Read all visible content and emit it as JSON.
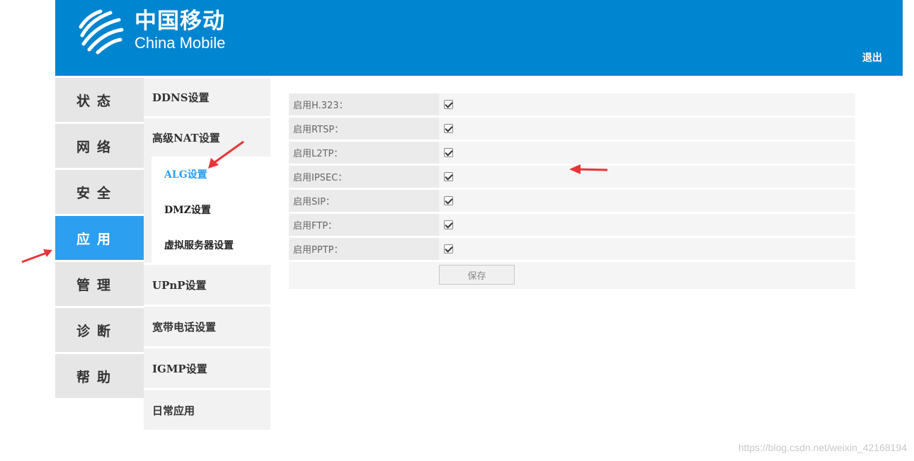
{
  "header": {
    "brand_cn": "中国移动",
    "brand_en": "China Mobile",
    "logout_label": "退出",
    "bg_color": "#0085d0"
  },
  "main_nav": [
    {
      "label": "状态",
      "active": false
    },
    {
      "label": "网络",
      "active": false
    },
    {
      "label": "安全",
      "active": false
    },
    {
      "label": "应用",
      "active": true
    },
    {
      "label": "管理",
      "active": false
    },
    {
      "label": "诊断",
      "active": false
    },
    {
      "label": "帮助",
      "active": false
    }
  ],
  "sub_nav": {
    "ddns": "DDNS设置",
    "nat": "高级NAT设置",
    "nat_children": [
      "ALG设置",
      "DMZ设置",
      "虚拟服务器设置"
    ],
    "upnp": "UPnP设置",
    "voip": "宽带电话设置",
    "igmp": "IGMP设置",
    "daily": "日常应用"
  },
  "alg_form": {
    "rows": [
      {
        "label": "启用H.323：",
        "checked": true
      },
      {
        "label": "启用RTSP：",
        "checked": true
      },
      {
        "label": "启用L2TP：",
        "checked": true
      },
      {
        "label": "启用IPSEC：",
        "checked": true
      },
      {
        "label": "启用SIP：",
        "checked": true
      },
      {
        "label": "启用FTP：",
        "checked": true
      },
      {
        "label": "启用PPTP：",
        "checked": true
      }
    ],
    "save_label": "保存"
  },
  "watermark": "https://blog.csdn.net/weixin_42168194",
  "colors": {
    "accent": "#2c9ff0",
    "annotation_arrow": "#e8353a"
  }
}
